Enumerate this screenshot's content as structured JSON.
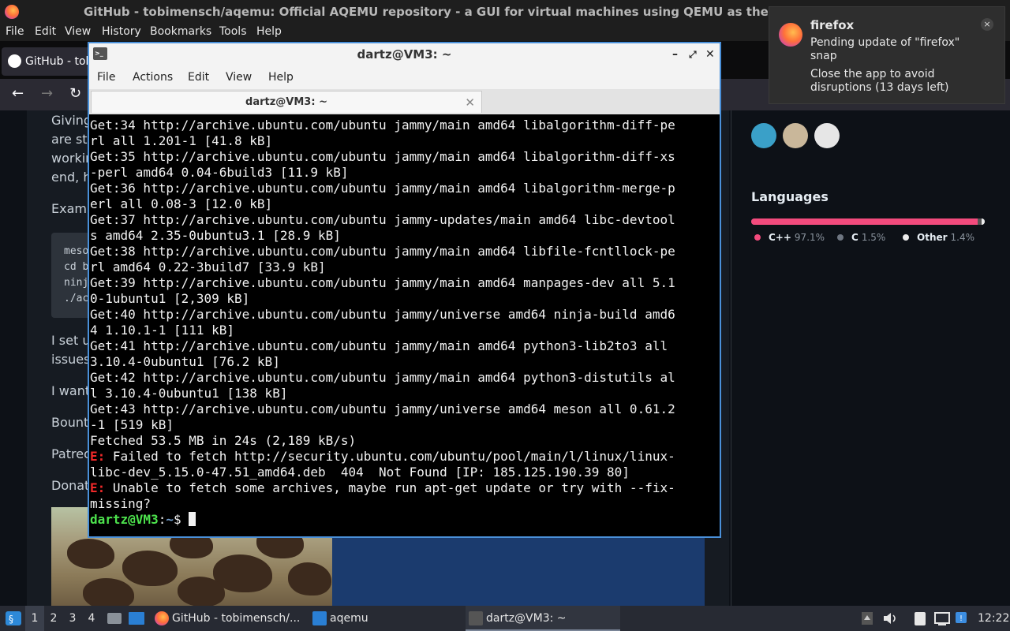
{
  "firefox": {
    "window_title": "GitHub - tobimensch/aqemu: Official AQEMU repository - a GUI for virtual machines using QEMU as the backend",
    "menu": [
      "File",
      "Edit",
      "View",
      "History",
      "Bookmarks",
      "Tools",
      "Help"
    ],
    "tab_label": "GitHub - tobimensch/aqemu",
    "nav": {
      "back": "←",
      "forward": "→",
      "reload": "↻"
    }
  },
  "github_page": {
    "partial_lines": [
      "Giving",
      "are sti",
      "workin",
      "end, h",
      "Examp",
      "I set u",
      "issues",
      "I want",
      "Bounty",
      "Patreo",
      "Donate"
    ],
    "code_lines": [
      "meso",
      "cd b",
      "ninj",
      "./ac"
    ],
    "languages": {
      "title": "Languages",
      "items": [
        {
          "name": "C++",
          "percent": "97.1%",
          "value": 97.1,
          "color": "#f34b7d"
        },
        {
          "name": "C",
          "percent": "1.5%",
          "value": 1.5,
          "color": "#555555"
        },
        {
          "name": "Other",
          "percent": "1.4%",
          "value": 1.4,
          "color": "#ededed"
        }
      ]
    }
  },
  "notification": {
    "app": "firefox",
    "line1": "Pending update of \"firefox\" snap",
    "line2": "Close the app to avoid disruptions (13 days left)",
    "close": "×"
  },
  "terminal": {
    "title": "dartz@VM3: ~",
    "menu": [
      "File",
      "Actions",
      "Edit",
      "View",
      "Help"
    ],
    "tab_label": "dartz@VM3: ~",
    "tab_close": "✕",
    "controls": {
      "minimize": "–",
      "maximize": "⤢",
      "close": "✕"
    },
    "lines": [
      "Get:34 http://archive.ubuntu.com/ubuntu jammy/main amd64 libalgorithm-diff-pe",
      "rl all 1.201-1 [41.8 kB]",
      "Get:35 http://archive.ubuntu.com/ubuntu jammy/main amd64 libalgorithm-diff-xs",
      "-perl amd64 0.04-6build3 [11.9 kB]",
      "Get:36 http://archive.ubuntu.com/ubuntu jammy/main amd64 libalgorithm-merge-p",
      "erl all 0.08-3 [12.0 kB]",
      "Get:37 http://archive.ubuntu.com/ubuntu jammy-updates/main amd64 libc-devtool",
      "s amd64 2.35-0ubuntu3.1 [28.9 kB]",
      "Get:38 http://archive.ubuntu.com/ubuntu jammy/main amd64 libfile-fcntllock-pe",
      "rl amd64 0.22-3build7 [33.9 kB]",
      "Get:39 http://archive.ubuntu.com/ubuntu jammy/main amd64 manpages-dev all 5.1",
      "0-1ubuntu1 [2,309 kB]",
      "Get:40 http://archive.ubuntu.com/ubuntu jammy/universe amd64 ninja-build amd6",
      "4 1.10.1-1 [111 kB]",
      "Get:41 http://archive.ubuntu.com/ubuntu jammy/main amd64 python3-lib2to3 all",
      "3.10.4-0ubuntu1 [76.2 kB]",
      "Get:42 http://archive.ubuntu.com/ubuntu jammy/main amd64 python3-distutils al",
      "l 3.10.4-0ubuntu1 [138 kB]",
      "Get:43 http://archive.ubuntu.com/ubuntu jammy/universe amd64 meson all 0.61.2",
      "-1 [519 kB]",
      "Fetched 53.5 MB in 24s (2,189 kB/s)"
    ],
    "errors": [
      {
        "tag": "E:",
        "lines": [
          " Failed to fetch http://security.ubuntu.com/ubuntu/pool/main/l/linux/linux-",
          "libc-dev_5.15.0-47.51_amd64.deb  404  Not Found [IP: 185.125.190.39 80]"
        ]
      },
      {
        "tag": "E:",
        "lines": [
          " Unable to fetch some archives, maybe run apt-get update or try with --fix-",
          "missing?"
        ]
      }
    ],
    "prompt": {
      "user": "dartz@VM3",
      "sep": ":",
      "path": "~",
      "symbol": "$ "
    }
  },
  "taskbar": {
    "workspaces": [
      "1",
      "2",
      "3",
      "4"
    ],
    "tasks": [
      "GitHub - tobimensch/...",
      "aqemu",
      "dartz@VM3: ~"
    ],
    "clock": "12:22"
  },
  "colors": {
    "terminal_border": "#4a90d9",
    "prompt_user": "#4de34d",
    "prompt_path": "#729fcf",
    "error": "#ef2929"
  }
}
